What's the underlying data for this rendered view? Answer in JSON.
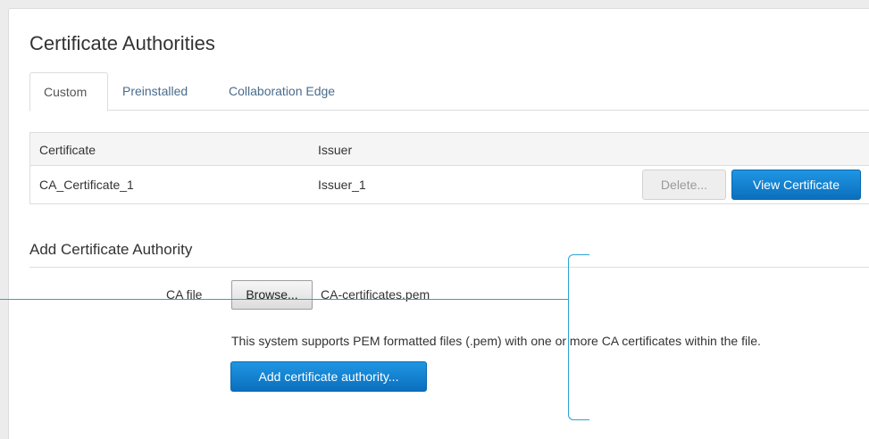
{
  "page": {
    "title": "Certificate Authorities"
  },
  "tabs": [
    {
      "label": "Custom",
      "active": true
    },
    {
      "label": "Preinstalled",
      "active": false
    },
    {
      "label": "Collaboration Edge",
      "active": false
    }
  ],
  "table": {
    "columns": [
      "Certificate",
      "Issuer"
    ],
    "rows": [
      {
        "certificate": "CA_Certificate_1",
        "issuer": "Issuer_1",
        "delete_label": "Delete...",
        "view_label": "View Certificate"
      }
    ]
  },
  "add_section": {
    "title": "Add Certificate Authority",
    "ca_file_label": "CA file",
    "browse_label": "Browse...",
    "selected_file": "CA-certificates.pem",
    "help_text": "This system supports PEM formatted files (.pem) with one or more CA certificates within the file.",
    "submit_label": "Add certificate authority..."
  },
  "colors": {
    "accent": "#0b6fbd",
    "callout": "#2ba3d3",
    "tab_link": "#4a6c8c"
  }
}
